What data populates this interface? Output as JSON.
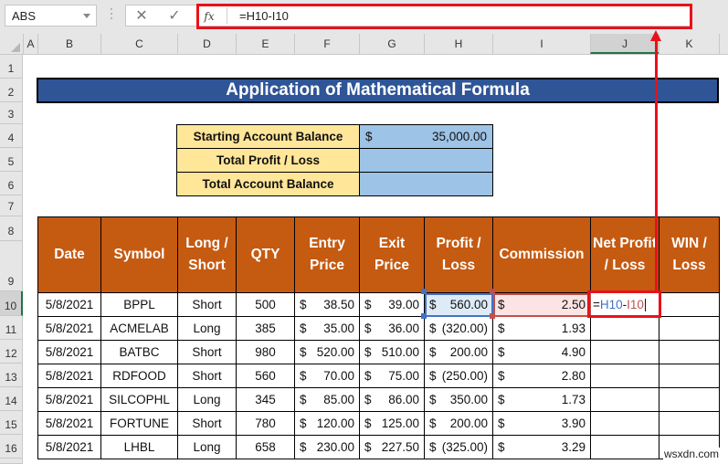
{
  "formula_bar": {
    "name_box": "ABS",
    "cancel_icon": "✕",
    "enter_icon": "✓",
    "fx_label": "fx",
    "formula": "=H10-I10"
  },
  "columns": [
    "A",
    "B",
    "C",
    "D",
    "E",
    "F",
    "G",
    "H",
    "I",
    "J",
    "K"
  ],
  "selected_column": "J",
  "rows": [
    "1",
    "2",
    "3",
    "4",
    "5",
    "6",
    "7",
    "8",
    "9",
    "10",
    "11",
    "12",
    "13",
    "14",
    "15",
    "16"
  ],
  "selected_row": "10",
  "title": "Application of Mathematical Formula",
  "summary": [
    {
      "label": "Starting Account Balance",
      "currency": "$",
      "value": "35,000.00"
    },
    {
      "label": "Total Profit / Loss",
      "currency": "",
      "value": ""
    },
    {
      "label": "Total Account Balance",
      "currency": "",
      "value": ""
    }
  ],
  "table": {
    "headers": [
      "Date",
      "Symbol",
      "Long / Short",
      "QTY",
      "Entry Price",
      "Exit Price",
      "Profit / Loss",
      "Commission",
      "Net Profit / Loss",
      "WIN / Loss"
    ],
    "rows": [
      {
        "date": "5/8/2021",
        "symbol": "BPPL",
        "side": "Short",
        "qty": "500",
        "entry": "38.50",
        "exit": "39.00",
        "pl": "560.00",
        "commission": "2.50",
        "net": "",
        "win": ""
      },
      {
        "date": "5/8/2021",
        "symbol": "ACMELAB",
        "side": "Long",
        "qty": "385",
        "entry": "35.00",
        "exit": "36.00",
        "pl": "(320.00)",
        "commission": "1.93",
        "net": "",
        "win": ""
      },
      {
        "date": "5/8/2021",
        "symbol": "BATBC",
        "side": "Short",
        "qty": "980",
        "entry": "520.00",
        "exit": "510.00",
        "pl": "200.00",
        "commission": "4.90",
        "net": "",
        "win": ""
      },
      {
        "date": "5/8/2021",
        "symbol": "RDFOOD",
        "side": "Short",
        "qty": "560",
        "entry": "70.00",
        "exit": "75.00",
        "pl": "(250.00)",
        "commission": "2.80",
        "net": "",
        "win": ""
      },
      {
        "date": "5/8/2021",
        "symbol": "SILCOPHL",
        "side": "Long",
        "qty": "345",
        "entry": "85.00",
        "exit": "86.00",
        "pl": "350.00",
        "commission": "1.73",
        "net": "",
        "win": ""
      },
      {
        "date": "5/8/2021",
        "symbol": "FORTUNE",
        "side": "Short",
        "qty": "780",
        "entry": "120.00",
        "exit": "125.00",
        "pl": "200.00",
        "commission": "3.90",
        "net": "",
        "win": ""
      },
      {
        "date": "5/8/2021",
        "symbol": "LHBL",
        "side": "Long",
        "qty": "658",
        "entry": "230.00",
        "exit": "227.50",
        "pl": "(325.00)",
        "commission": "3.29",
        "net": "",
        "win": ""
      }
    ],
    "currency": "$"
  },
  "editing_cell": {
    "ref": "J10",
    "parts": {
      "eq": "=",
      "h": "H10",
      "op": "-",
      "i": "I10"
    }
  },
  "colors": {
    "title_bg": "#2f5597",
    "header_bg": "#c55a11",
    "summary_label_bg": "#ffe699",
    "summary_value_bg": "#9dc3e6",
    "annotation_red": "#e8111a",
    "ref_blue": "#4472c4",
    "ref_red": "#c0504d"
  },
  "watermark": "wsxdn.com"
}
